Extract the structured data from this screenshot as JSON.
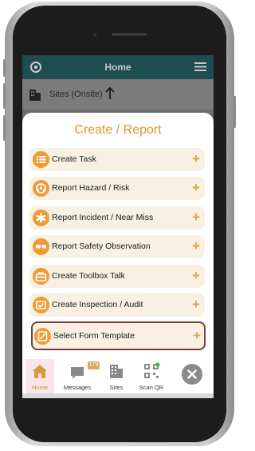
{
  "header": {
    "title": "Home",
    "settings_icon": "gear-icon",
    "menu_icon": "hamburger-menu-icon"
  },
  "sites_bar": {
    "label": "Sites (Onsite)",
    "sort_icon": "arrow-up-icon"
  },
  "sheet": {
    "title": "Create / Report",
    "items": [
      {
        "label": "Create Task",
        "icon": "list-icon",
        "action": "+"
      },
      {
        "label": "Report Hazard / Risk",
        "icon": "hazard-icon",
        "action": "+"
      },
      {
        "label": "Report Incident / Near Miss",
        "icon": "incident-icon",
        "action": "+"
      },
      {
        "label": "Report Safety Observation",
        "icon": "glasses-icon",
        "action": "+"
      },
      {
        "label": "Create Toolbox Talk",
        "icon": "toolbox-icon",
        "action": "+"
      },
      {
        "label": "Create Inspection / Audit",
        "icon": "inspection-icon",
        "action": "+"
      },
      {
        "label": "Select Form Template",
        "icon": "form-icon",
        "action": "+"
      }
    ]
  },
  "bottom_nav": {
    "items": [
      {
        "label": "Home",
        "icon": "home-icon"
      },
      {
        "label": "Messages",
        "icon": "chat-icon",
        "badge": "173"
      },
      {
        "label": "Sites",
        "icon": "building-icon"
      },
      {
        "label": "Scan QR",
        "icon": "qr-code-icon"
      }
    ],
    "close_icon": "close-icon"
  },
  "colors": {
    "accent": "#e8922e",
    "header": "#1e4d4f",
    "item_bg": "#f7f0e3",
    "selected_border": "#7d3d3d"
  }
}
